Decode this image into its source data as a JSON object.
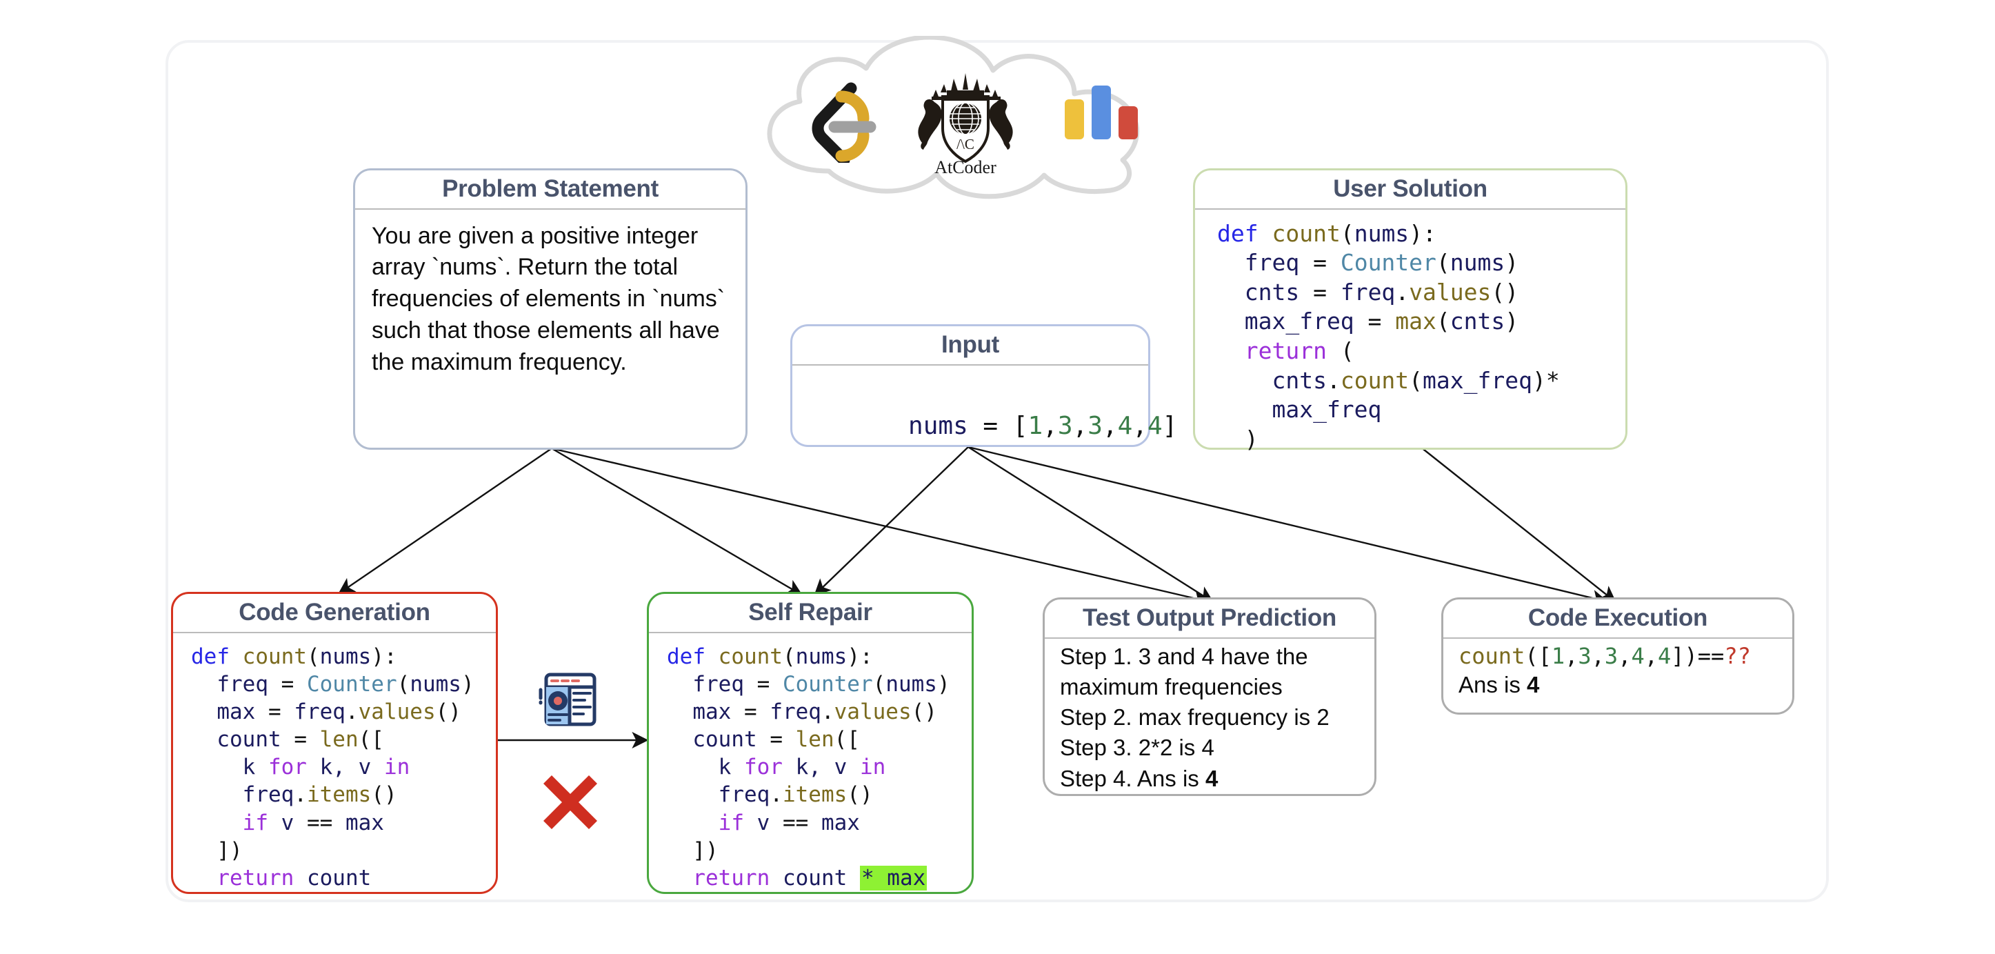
{
  "diagram": {
    "title": "Code Reasoning Tasks Overview",
    "cloud": {
      "name": "coding-platforms-cloud",
      "logos": [
        {
          "id": "leetcode",
          "label": "LeetCode"
        },
        {
          "id": "atcoder",
          "label": "AtCoder"
        },
        {
          "id": "codejam",
          "label": "Google Code Jam"
        }
      ],
      "atcoder_wordmark": "AtCoder"
    },
    "boxes": {
      "problem_statement": {
        "title": "Problem Statement",
        "body": "You are given a positive integer array `nums`. Return the total frequencies of elements in `nums` such that those elements all have the maximum frequency.",
        "border_color": "#b2bdd0"
      },
      "input": {
        "title": "Input",
        "code": {
          "var": "nums",
          "eq": " = ",
          "open": "[",
          "values": [
            "1",
            "3",
            "3",
            "4",
            "4"
          ],
          "close": "]"
        },
        "border_color": "#b7c4e4"
      },
      "user_solution": {
        "title": "User Solution",
        "lines": [
          [
            {
              "t": "def ",
              "c": "k-def"
            },
            {
              "t": "count",
              "c": "k-fn"
            },
            {
              "t": "(",
              "c": "k-punc"
            },
            {
              "t": "nums",
              "c": "k-id"
            },
            {
              "t": "):",
              "c": "k-punc"
            }
          ],
          [
            {
              "t": "  freq ",
              "c": "k-id"
            },
            {
              "t": "= ",
              "c": "k-punc"
            },
            {
              "t": "Counter",
              "c": "k-cls"
            },
            {
              "t": "(",
              "c": "k-punc"
            },
            {
              "t": "nums",
              "c": "k-id"
            },
            {
              "t": ")",
              "c": "k-punc"
            }
          ],
          [
            {
              "t": "  cnts ",
              "c": "k-id"
            },
            {
              "t": "= ",
              "c": "k-punc"
            },
            {
              "t": "freq",
              "c": "k-id"
            },
            {
              "t": ".",
              "c": "k-punc"
            },
            {
              "t": "values",
              "c": "k-fn"
            },
            {
              "t": "()",
              "c": "k-punc"
            }
          ],
          [
            {
              "t": "  max_freq ",
              "c": "k-id"
            },
            {
              "t": "= ",
              "c": "k-punc"
            },
            {
              "t": "max",
              "c": "k-fn"
            },
            {
              "t": "(",
              "c": "k-punc"
            },
            {
              "t": "cnts",
              "c": "k-id"
            },
            {
              "t": ")",
              "c": "k-punc"
            }
          ],
          [
            {
              "t": "  return ",
              "c": "k-kw"
            },
            {
              "t": "(",
              "c": "k-punc"
            }
          ],
          [
            {
              "t": "    cnts",
              "c": "k-id"
            },
            {
              "t": ".",
              "c": "k-punc"
            },
            {
              "t": "count",
              "c": "k-fn"
            },
            {
              "t": "(",
              "c": "k-punc"
            },
            {
              "t": "max_freq",
              "c": "k-id"
            },
            {
              "t": ")*",
              "c": "k-punc"
            }
          ],
          [
            {
              "t": "    max_freq",
              "c": "k-id"
            }
          ],
          [
            {
              "t": "  )",
              "c": "k-punc"
            }
          ]
        ],
        "border_color": "#cbdcb0"
      },
      "code_generation": {
        "title": "Code Generation",
        "lines": [
          [
            {
              "t": "def ",
              "c": "k-def"
            },
            {
              "t": "count",
              "c": "k-fn"
            },
            {
              "t": "(",
              "c": "k-punc"
            },
            {
              "t": "nums",
              "c": "k-id"
            },
            {
              "t": "):",
              "c": "k-punc"
            }
          ],
          [
            {
              "t": "  freq ",
              "c": "k-id"
            },
            {
              "t": "= ",
              "c": "k-punc"
            },
            {
              "t": "Counter",
              "c": "k-cls"
            },
            {
              "t": "(",
              "c": "k-punc"
            },
            {
              "t": "nums",
              "c": "k-id"
            },
            {
              "t": ")",
              "c": "k-punc"
            }
          ],
          [
            {
              "t": "  max ",
              "c": "k-id"
            },
            {
              "t": "= ",
              "c": "k-punc"
            },
            {
              "t": "freq",
              "c": "k-id"
            },
            {
              "t": ".",
              "c": "k-punc"
            },
            {
              "t": "values",
              "c": "k-fn"
            },
            {
              "t": "()",
              "c": "k-punc"
            }
          ],
          [
            {
              "t": "  count ",
              "c": "k-id"
            },
            {
              "t": "= ",
              "c": "k-punc"
            },
            {
              "t": "len",
              "c": "k-fn"
            },
            {
              "t": "([",
              "c": "k-punc"
            }
          ],
          [
            {
              "t": "    k ",
              "c": "k-id"
            },
            {
              "t": "for ",
              "c": "k-kw"
            },
            {
              "t": "k, v ",
              "c": "k-id"
            },
            {
              "t": "in",
              "c": "k-kw"
            }
          ],
          [
            {
              "t": "    freq",
              "c": "k-id"
            },
            {
              "t": ".",
              "c": "k-punc"
            },
            {
              "t": "items",
              "c": "k-fn"
            },
            {
              "t": "()",
              "c": "k-punc"
            }
          ],
          [
            {
              "t": "    if ",
              "c": "k-kw"
            },
            {
              "t": "v ",
              "c": "k-id"
            },
            {
              "t": "== ",
              "c": "k-punc"
            },
            {
              "t": "max",
              "c": "k-id"
            }
          ],
          [
            {
              "t": "  ])",
              "c": "k-punc"
            }
          ],
          [
            {
              "t": "  return ",
              "c": "k-kw"
            },
            {
              "t": "count",
              "c": "k-id"
            }
          ]
        ],
        "border_color": "#d5331f"
      },
      "self_repair": {
        "title": "Self Repair",
        "lines": [
          [
            {
              "t": "def ",
              "c": "k-def"
            },
            {
              "t": "count",
              "c": "k-fn"
            },
            {
              "t": "(",
              "c": "k-punc"
            },
            {
              "t": "nums",
              "c": "k-id"
            },
            {
              "t": "):",
              "c": "k-punc"
            }
          ],
          [
            {
              "t": "  freq ",
              "c": "k-id"
            },
            {
              "t": "= ",
              "c": "k-punc"
            },
            {
              "t": "Counter",
              "c": "k-cls"
            },
            {
              "t": "(",
              "c": "k-punc"
            },
            {
              "t": "nums",
              "c": "k-id"
            },
            {
              "t": ")",
              "c": "k-punc"
            }
          ],
          [
            {
              "t": "  max ",
              "c": "k-id"
            },
            {
              "t": "= ",
              "c": "k-punc"
            },
            {
              "t": "freq",
              "c": "k-id"
            },
            {
              "t": ".",
              "c": "k-punc"
            },
            {
              "t": "values",
              "c": "k-fn"
            },
            {
              "t": "()",
              "c": "k-punc"
            }
          ],
          [
            {
              "t": "  count ",
              "c": "k-id"
            },
            {
              "t": "= ",
              "c": "k-punc"
            },
            {
              "t": "len",
              "c": "k-fn"
            },
            {
              "t": "([",
              "c": "k-punc"
            }
          ],
          [
            {
              "t": "    k ",
              "c": "k-id"
            },
            {
              "t": "for ",
              "c": "k-kw"
            },
            {
              "t": "k, v ",
              "c": "k-id"
            },
            {
              "t": "in",
              "c": "k-kw"
            }
          ],
          [
            {
              "t": "    freq",
              "c": "k-id"
            },
            {
              "t": ".",
              "c": "k-punc"
            },
            {
              "t": "items",
              "c": "k-fn"
            },
            {
              "t": "()",
              "c": "k-punc"
            }
          ],
          [
            {
              "t": "    if ",
              "c": "k-kw"
            },
            {
              "t": "v ",
              "c": "k-id"
            },
            {
              "t": "== ",
              "c": "k-punc"
            },
            {
              "t": "max",
              "c": "k-id"
            }
          ],
          [
            {
              "t": "  ])",
              "c": "k-punc"
            }
          ],
          [
            {
              "t": "  return ",
              "c": "k-kw"
            },
            {
              "t": "count ",
              "c": "k-id"
            },
            {
              "t": "* max",
              "c": "k-id hl"
            }
          ]
        ],
        "border_color": "#4aa83f"
      },
      "test_output_prediction": {
        "title": "Test Output Prediction",
        "steps": [
          {
            "text": "Step 1. 3 and 4  have the maximum frequencies",
            "bold_tail": ""
          },
          {
            "text": "Step 2. max frequency is 2",
            "bold_tail": ""
          },
          {
            "text": "Step 3. 2*2 is 4",
            "bold_tail": ""
          },
          {
            "text": "Step 4. Ans is ",
            "bold_tail": "4"
          }
        ],
        "border_color": "#adadad"
      },
      "code_execution": {
        "title": "Code Execution",
        "call": {
          "fn": "count",
          "open": "([",
          "values": [
            "1",
            "3",
            "3",
            "4",
            "4"
          ],
          "close": "])",
          "eq": "==",
          "unknown": "??"
        },
        "answer_prefix": "Ans is ",
        "answer_value": "4",
        "border_color": "#adadad"
      }
    },
    "icons": {
      "repair_tool": "debug-window-gear-icon",
      "failure": "red-x-icon"
    }
  }
}
